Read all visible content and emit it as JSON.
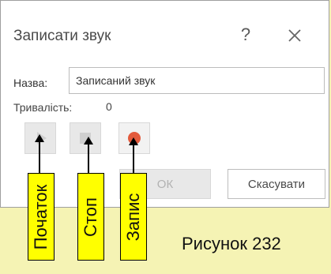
{
  "dialog": {
    "title": "Записати звук",
    "help_symbol": "?",
    "name_label": "Назва:",
    "name_value": "Записаний звук",
    "duration_label": "Тривалість:",
    "duration_value": "0",
    "ok_label": "ОК",
    "cancel_label": "Скасувати"
  },
  "icons": {
    "help": "help-icon",
    "close": "close-icon",
    "play": "play-icon",
    "stop": "stop-icon",
    "record": "record-icon"
  },
  "callouts": {
    "start": "Початок",
    "stop": "Стоп",
    "record": "Запис"
  },
  "caption": "Рисунок 232",
  "colors": {
    "background": "#f5f3b4",
    "callout_fill": "#ffff00",
    "record": "#e35a3c",
    "disabled": "#cfcfcf"
  }
}
